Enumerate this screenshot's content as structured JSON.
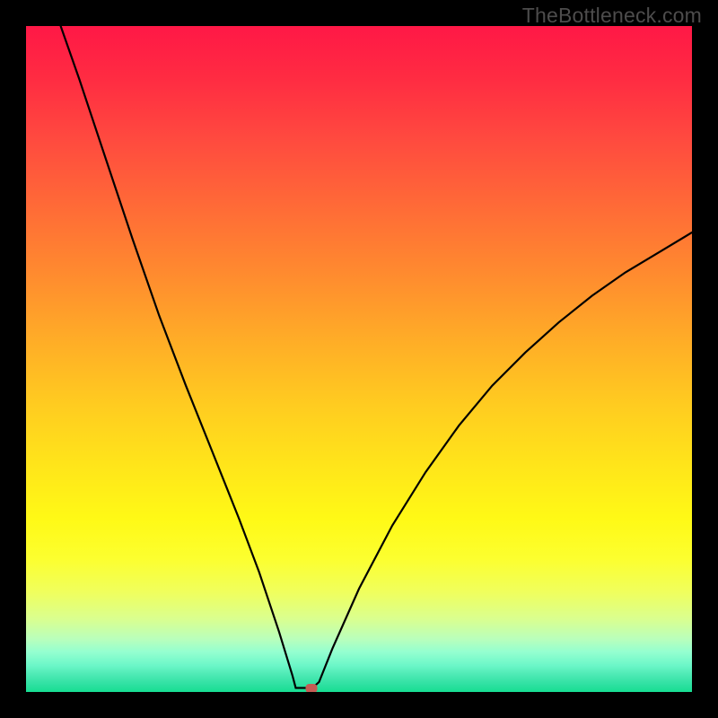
{
  "watermark": {
    "text": "TheBottleneck.com"
  },
  "chart_data": {
    "type": "line",
    "title": "",
    "xlabel": "",
    "ylabel": "",
    "xlim": [
      0,
      100
    ],
    "ylim": [
      0,
      100
    ],
    "marker": {
      "x": 42.8,
      "y": 0.6
    },
    "curve_points": [
      {
        "x": 5.2,
        "y": 100.0
      },
      {
        "x": 8.0,
        "y": 92.0
      },
      {
        "x": 12.0,
        "y": 80.0
      },
      {
        "x": 16.0,
        "y": 68.0
      },
      {
        "x": 20.0,
        "y": 56.5
      },
      {
        "x": 24.0,
        "y": 46.0
      },
      {
        "x": 28.0,
        "y": 36.0
      },
      {
        "x": 32.0,
        "y": 26.0
      },
      {
        "x": 35.0,
        "y": 18.0
      },
      {
        "x": 38.0,
        "y": 9.0
      },
      {
        "x": 40.0,
        "y": 2.5
      },
      {
        "x": 40.5,
        "y": 0.6
      },
      {
        "x": 43.0,
        "y": 0.6
      },
      {
        "x": 44.0,
        "y": 1.5
      },
      {
        "x": 46.0,
        "y": 6.5
      },
      {
        "x": 50.0,
        "y": 15.5
      },
      {
        "x": 55.0,
        "y": 25.0
      },
      {
        "x": 60.0,
        "y": 33.0
      },
      {
        "x": 65.0,
        "y": 40.0
      },
      {
        "x": 70.0,
        "y": 46.0
      },
      {
        "x": 75.0,
        "y": 51.0
      },
      {
        "x": 80.0,
        "y": 55.5
      },
      {
        "x": 85.0,
        "y": 59.5
      },
      {
        "x": 90.0,
        "y": 63.0
      },
      {
        "x": 95.0,
        "y": 66.0
      },
      {
        "x": 100.0,
        "y": 69.0
      }
    ],
    "gradient_colors": {
      "top": "#ff1846",
      "middle": "#fff916",
      "bottom": "#17de92"
    }
  }
}
